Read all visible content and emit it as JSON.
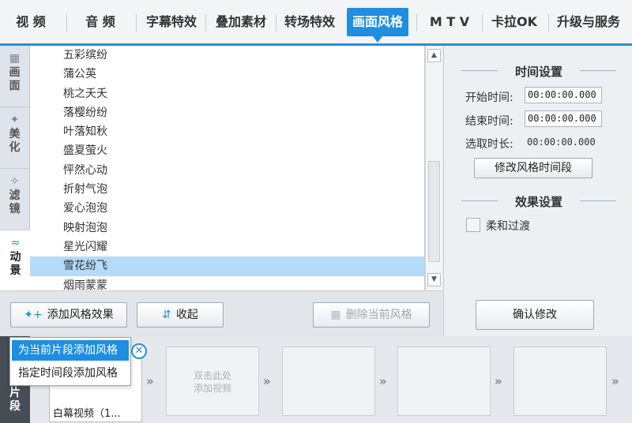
{
  "tabs": [
    {
      "label": "视  频"
    },
    {
      "label": "音  频"
    },
    {
      "label": "字幕特效"
    },
    {
      "label": "叠加素材"
    },
    {
      "label": "转场特效"
    },
    {
      "label": "画面风格"
    },
    {
      "label": "M T V"
    },
    {
      "label": "卡拉OK"
    },
    {
      "label": "升级与服务"
    }
  ],
  "sidebar": {
    "items": [
      {
        "label": "画面"
      },
      {
        "label": "美化"
      },
      {
        "label": "滤镜"
      },
      {
        "label": "动景"
      }
    ]
  },
  "effects": {
    "items": [
      "五彩缤纷",
      "蒲公英",
      "桃之夭夭",
      "落樱纷纷",
      "叶落知秋",
      "盛夏萤火",
      "怦然心动",
      "折射气泡",
      "爱心泡泡",
      "映射泡泡",
      "星光闪耀",
      "雪花纷飞",
      "烟雨蒙蒙"
    ],
    "selected": "雪花纷飞"
  },
  "time_settings": {
    "heading": "时间设置",
    "start_label": "开始时间:",
    "start_value": "00:00:00.000",
    "end_label": "结束时间:",
    "end_value": "00:00:00.000",
    "duration_label": "选取时长:",
    "duration_value": "00:00:00.000",
    "modify_button": "修改风格时间段"
  },
  "effect_settings": {
    "heading": "效果设置",
    "soft_transition_label": "柔和过渡",
    "soft_transition_checked": false
  },
  "confirm_button": "确认修改",
  "toolbar": {
    "add_label": "添加风格效果",
    "collapse_label": "收起",
    "delete_label": "删除当前风格"
  },
  "popup": {
    "options": [
      "为当前片段添加风格",
      "指定时间段添加风格"
    ]
  },
  "clips": {
    "side_label": "片段",
    "first_caption": "白幕视频（1...",
    "placeholder_text": "双击此处\n添加视频"
  }
}
